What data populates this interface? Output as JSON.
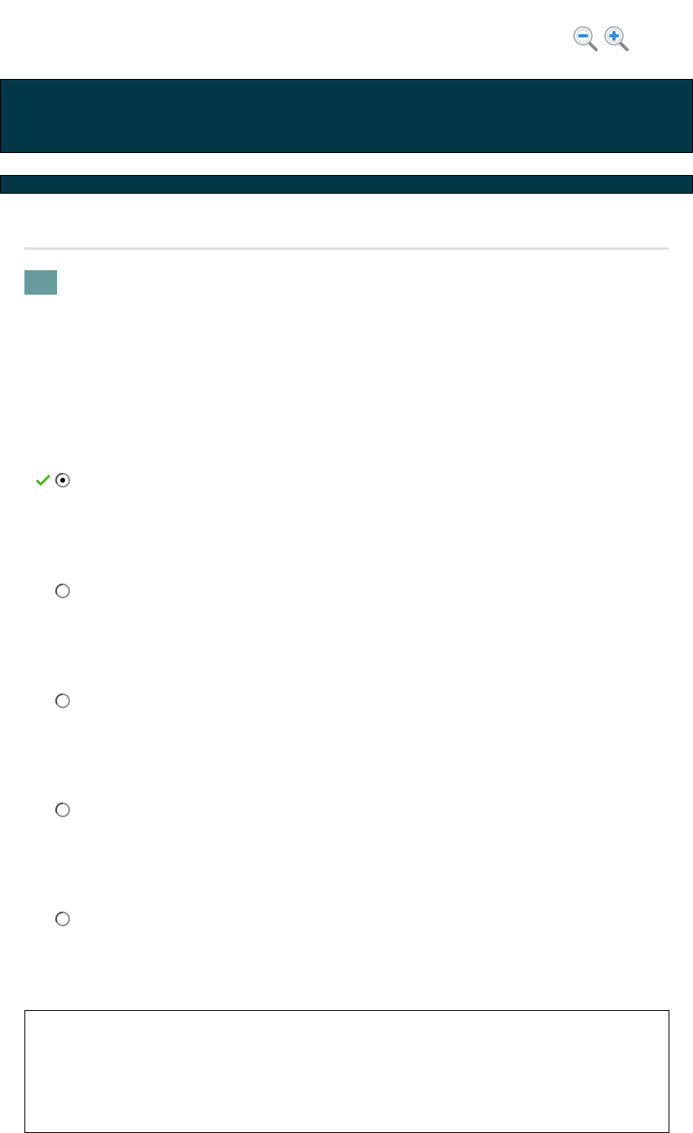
{
  "colors": {
    "banner": "#023748",
    "number_badge": "#679b9c",
    "divider": "#dddddd",
    "check": "#45b51f",
    "zoom_icon_blue": "#2f8fd6"
  },
  "toolbar": {
    "zoom_out_icon": "zoom-out-icon",
    "zoom_in_icon": "zoom-in-icon"
  },
  "question": {
    "selected_index": 0,
    "correct_index": 0,
    "options": [
      {
        "label": "",
        "selected": true,
        "correct": true
      },
      {
        "label": "",
        "selected": false,
        "correct": false
      },
      {
        "label": "",
        "selected": false,
        "correct": false
      },
      {
        "label": "",
        "selected": false,
        "correct": false
      },
      {
        "label": "",
        "selected": false,
        "correct": false
      }
    ]
  }
}
